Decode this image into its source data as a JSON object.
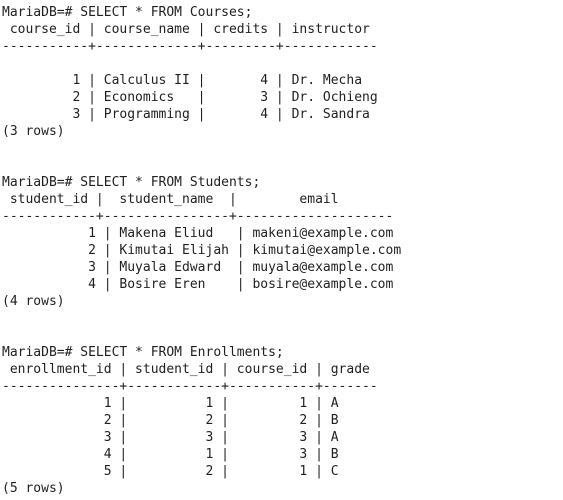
{
  "terminal": {
    "lines": [
      "MariaDB=# SELECT * FROM Courses;",
      " course_id | course_name | credits | instructor",
      "-----------+-------------+---------+------------",
      "",
      "         1 | Calculus II |       4 | Dr. Mecha",
      "         2 | Economics   |       3 | Dr. Ochieng",
      "         3 | Programming |       4 | Dr. Sandra",
      "(3 rows)",
      "",
      "",
      "MariaDB=# SELECT * FROM Students;",
      " student_id |  student_name  |        email",
      "------------+----------------+--------------------",
      "           1 | Makena Eliud   | makeni@example.com",
      "           2 | Kimutai Elijah | kimutai@example.com",
      "           3 | Muyala Edward  | muyala@example.com",
      "           4 | Bosire Eren    | bosire@example.com",
      "(4 rows)",
      "",
      "",
      "MariaDB=# SELECT * FROM Enrollments;",
      " enrollment_id | student_id | course_id | grade",
      "---------------+------------+-----------+-------",
      "             1 |          1 |         1 | A",
      "             2 |          2 |         2 | B",
      "             3 |          3 |         3 | A",
      "             4 |          1 |         3 | B",
      "             5 |          2 |         1 | C",
      "(5 rows)"
    ]
  }
}
